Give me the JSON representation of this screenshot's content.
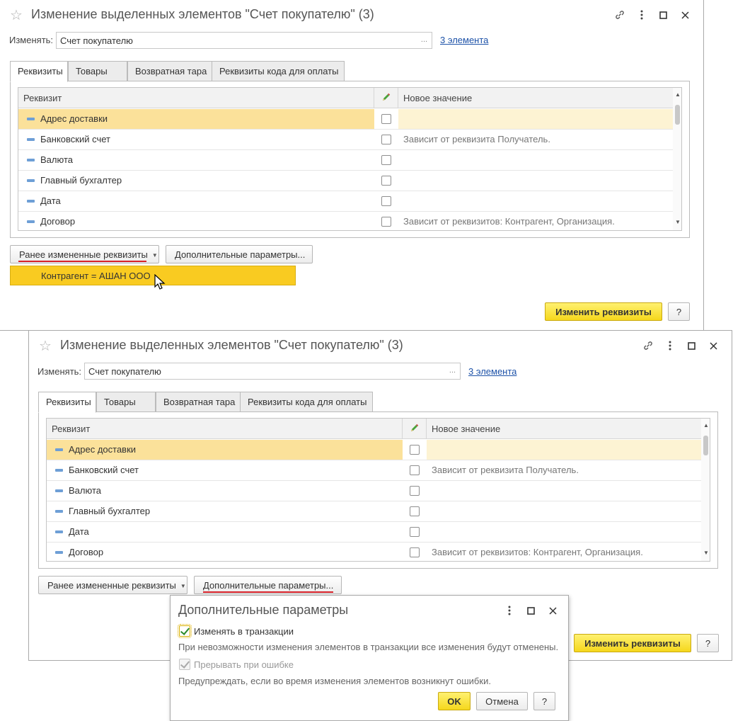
{
  "window": {
    "title": "Изменение выделенных элементов \"Счет покупателю\" (3)",
    "change_label": "Изменять:",
    "change_value": "Счет покупателю",
    "ellipsis": "...",
    "elements_link": "3 элемента",
    "tabs": [
      "Реквизиты",
      "Товары",
      "Возвратная тара",
      "Реквизиты кода для оплаты"
    ],
    "grid": {
      "headers": {
        "attribute": "Реквизит",
        "new_value": "Новое значение"
      },
      "rows": [
        {
          "name": "Адрес доставки",
          "checked": false,
          "value": "",
          "selected": true
        },
        {
          "name": "Банковский счет",
          "checked": false,
          "value": "Зависит от реквизита Получатель.",
          "selected": false
        },
        {
          "name": "Валюта",
          "checked": false,
          "value": "",
          "selected": false
        },
        {
          "name": "Главный бухгалтер",
          "checked": false,
          "value": "",
          "selected": false
        },
        {
          "name": "Дата",
          "checked": false,
          "value": "",
          "selected": false
        },
        {
          "name": "Договор",
          "checked": false,
          "value": "Зависит от реквизитов: Контрагент, Организация.",
          "selected": false
        }
      ]
    },
    "btn_prev_changed": "Ранее измененные реквизиты",
    "btn_additional": "Дополнительные параметры...",
    "btn_change": "Изменить реквизиты",
    "btn_help": "?"
  },
  "popup_item": "Контрагент = АШАН ООО",
  "dialog": {
    "title": "Дополнительные параметры",
    "opt1_label": "Изменять в транзакции",
    "opt1_checked": true,
    "opt1_hint": "При невозможности изменения элементов в транзакции все изменения будут отменены.",
    "opt2_label": "Прерывать при ошибке",
    "opt2_checked": true,
    "opt2_disabled": true,
    "opt2_hint": "Предупреждать, если во время изменения элементов возникнут ошибки.",
    "ok": "OK",
    "cancel": "Отмена",
    "help": "?"
  },
  "colors": {
    "primary_button": "#f5d71c",
    "selected_row": "#fbe19a",
    "link": "#1d52a8",
    "annotation_underline": "#d6222a"
  },
  "icons": [
    "star-icon",
    "link-icon",
    "more-icon",
    "maximize-icon",
    "close-icon",
    "pencil-icon",
    "row-icon",
    "mouse-cursor-icon"
  ]
}
